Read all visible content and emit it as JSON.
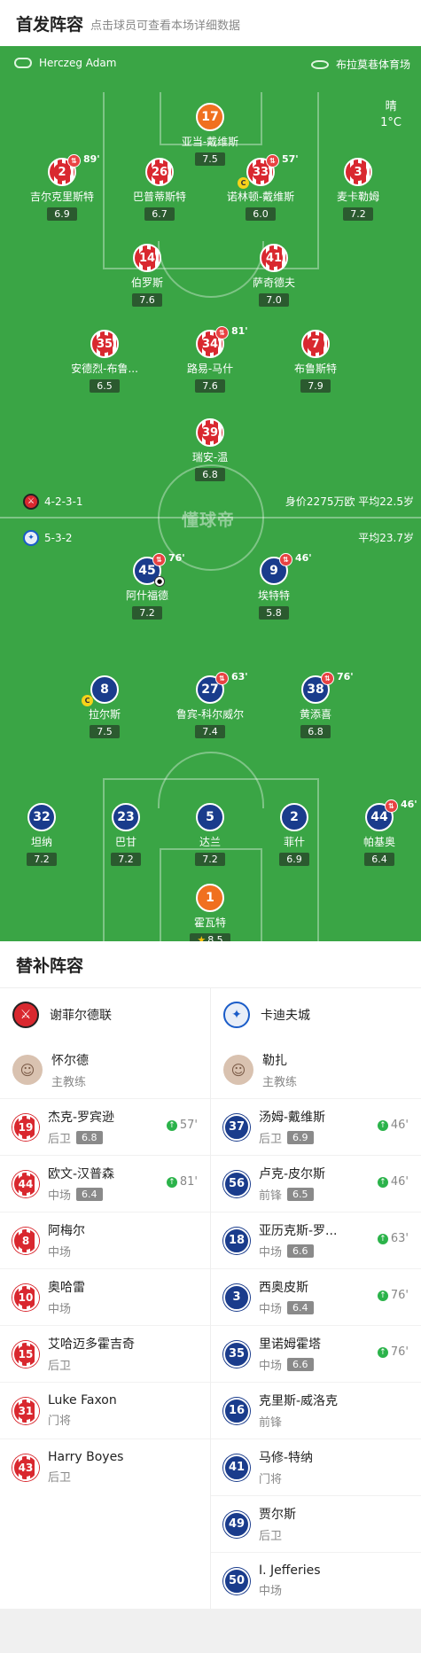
{
  "header": {
    "title": "首发阵容",
    "subtitle": "点击球员可查看本场详细数据"
  },
  "pitch": {
    "referee": "Herczeg Adam",
    "stadium": "布拉莫巷体育场",
    "weather": {
      "condition": "晴",
      "temp": "1°C"
    },
    "watermark": "懂球帝",
    "home": {
      "formation": "4-2-3-1",
      "value_info": "身价2275万欧 平均22.5岁"
    },
    "away": {
      "formation": "5-3-2",
      "age_info": "平均23.7岁"
    }
  },
  "home_players": [
    {
      "num": "17",
      "name": "亚当-戴维斯",
      "rating": "7.5"
    },
    {
      "num": "2",
      "name": "吉尔克里斯特",
      "rating": "6.9",
      "sub": "89'"
    },
    {
      "num": "26",
      "name": "巴普蒂斯特",
      "rating": "6.7"
    },
    {
      "num": "33",
      "name": "诺林顿-戴维斯",
      "rating": "6.0",
      "sub": "57'",
      "captain": "C"
    },
    {
      "num": "3",
      "name": "麦卡勒姆",
      "rating": "7.2"
    },
    {
      "num": "14",
      "name": "伯罗斯",
      "rating": "7.6"
    },
    {
      "num": "41",
      "name": "萨奇德夫",
      "rating": "7.0"
    },
    {
      "num": "35",
      "name": "安德烈-布鲁...",
      "rating": "6.5"
    },
    {
      "num": "34",
      "name": "路易-马什",
      "rating": "7.6",
      "sub": "81'"
    },
    {
      "num": "7",
      "name": "布鲁斯特",
      "rating": "7.9"
    },
    {
      "num": "39",
      "name": "瑞安-温",
      "rating": "6.8"
    }
  ],
  "away_players": [
    {
      "num": "45",
      "name": "阿什福德",
      "rating": "7.2",
      "sub": "76'"
    },
    {
      "num": "9",
      "name": "埃特特",
      "rating": "5.8",
      "sub": "46'"
    },
    {
      "num": "8",
      "name": "拉尔斯",
      "rating": "7.5",
      "captain": "C"
    },
    {
      "num": "27",
      "name": "鲁宾-科尔威尔",
      "rating": "7.4",
      "sub": "63'"
    },
    {
      "num": "38",
      "name": "黄添喜",
      "rating": "6.8",
      "sub": "76'"
    },
    {
      "num": "32",
      "name": "坦纳",
      "rating": "7.2"
    },
    {
      "num": "23",
      "name": "巴甘",
      "rating": "7.2"
    },
    {
      "num": "5",
      "name": "达兰",
      "rating": "7.2"
    },
    {
      "num": "2",
      "name": "菲什",
      "rating": "6.9"
    },
    {
      "num": "44",
      "name": "帕基奥",
      "rating": "6.4",
      "sub": "46'"
    },
    {
      "num": "1",
      "name": "霍瓦特",
      "rating": "8.5"
    }
  ],
  "subs": {
    "title": "替补阵容",
    "home_team": "谢菲尔德联",
    "away_team": "卡迪夫城",
    "home_coach": {
      "name": "怀尔德",
      "role": "主教练"
    },
    "away_coach": {
      "name": "勒扎",
      "role": "主教练"
    },
    "home": [
      {
        "num": "19",
        "name": "杰克-罗宾逊",
        "pos": "后卫",
        "rating": "6.8",
        "on": "57'"
      },
      {
        "num": "44",
        "name": "欧文-汉普森",
        "pos": "中场",
        "rating": "6.4",
        "on": "81'"
      },
      {
        "num": "8",
        "name": "阿梅尔",
        "pos": "中场"
      },
      {
        "num": "10",
        "name": "奥哈雷",
        "pos": "中场"
      },
      {
        "num": "15",
        "name": "艾哈迈多霍吉奇",
        "pos": "后卫"
      },
      {
        "num": "31",
        "name": "Luke Faxon",
        "pos": "门将"
      },
      {
        "num": "43",
        "name": "Harry Boyes",
        "pos": "后卫"
      }
    ],
    "away": [
      {
        "num": "37",
        "name": "汤姆-戴维斯",
        "pos": "后卫",
        "rating": "6.9",
        "on": "46'"
      },
      {
        "num": "56",
        "name": "卢克-皮尔斯",
        "pos": "前锋",
        "rating": "6.5",
        "on": "46'"
      },
      {
        "num": "18",
        "name": "亚历克斯-罗...",
        "pos": "中场",
        "rating": "6.6",
        "on": "63'"
      },
      {
        "num": "3",
        "name": "西奥皮斯",
        "pos": "中场",
        "rating": "6.4",
        "on": "76'"
      },
      {
        "num": "35",
        "name": "里诺姆霍塔",
        "pos": "中场",
        "rating": "6.6",
        "on": "76'"
      },
      {
        "num": "16",
        "name": "克里斯-威洛克",
        "pos": "前锋"
      },
      {
        "num": "41",
        "name": "马修-特纳",
        "pos": "门将"
      },
      {
        "num": "49",
        "name": "贾尔斯",
        "pos": "后卫"
      },
      {
        "num": "50",
        "name": "I. Jefferies",
        "pos": "中场"
      }
    ]
  },
  "colors": {
    "pitch": "#3aa545",
    "home": "#d9282f",
    "away": "#1a3c8c",
    "gk": "#f07020"
  }
}
